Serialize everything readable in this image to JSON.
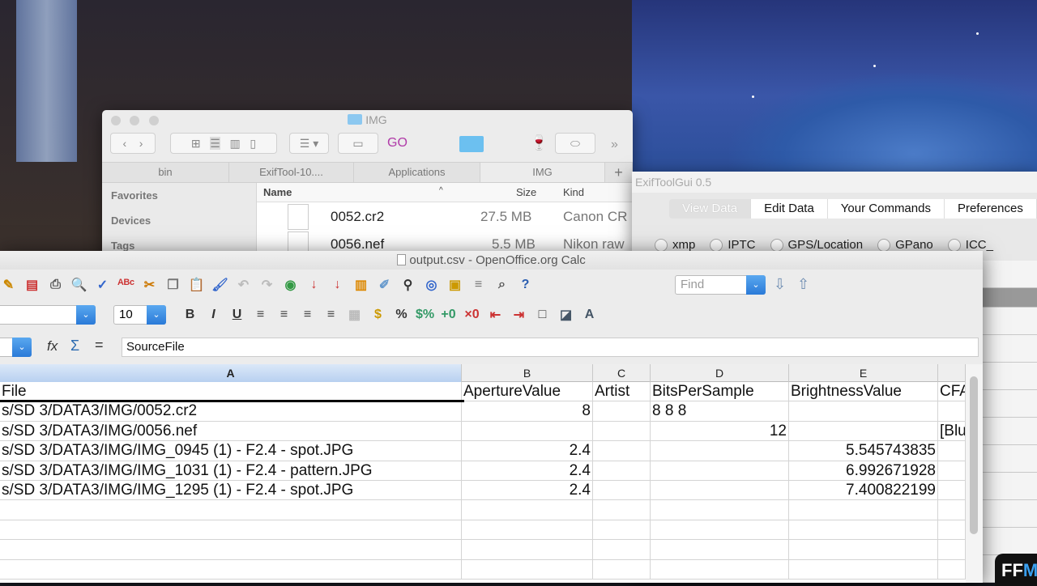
{
  "finder": {
    "title": "IMG",
    "go_label": "GO",
    "tabs": [
      "bin",
      "ExifTool-10....",
      "Applications",
      "IMG"
    ],
    "add_tab": "+",
    "sidebar": [
      "Favorites",
      "Devices",
      "Tags"
    ],
    "columns": {
      "name": "Name",
      "size": "Size",
      "kind": "Kind"
    },
    "files": [
      {
        "name": "0052.cr2",
        "size": "27.5 MB",
        "kind": "Canon CR"
      },
      {
        "name": "0056.nef",
        "size": "5.5 MB",
        "kind": "Nikon raw"
      }
    ]
  },
  "exiftoolgui": {
    "title": "ExifToolGui 0.5",
    "tabs": [
      "View Data",
      "Edit Data",
      "Your Commands",
      "Preferences"
    ],
    "radios": [
      "xmp",
      "IPTC",
      "GPS/Location",
      "GPano",
      "ICC_"
    ]
  },
  "calc": {
    "title": "output.csv - OpenOffice.org Calc",
    "font_size": "10",
    "find_placeholder": "Find",
    "formula": "SourceFile",
    "toolbar1": [
      [
        "edit-icon",
        "✎",
        "#c80"
      ],
      [
        "pdf-icon",
        "▤",
        "#c33"
      ],
      [
        "print-icon",
        "⎙",
        "#555"
      ],
      [
        "preview-icon",
        "🔍",
        "#555"
      ],
      [
        "spellcheck-icon",
        "✓",
        "#36c"
      ],
      [
        "autospell-icon",
        "ᴬᴮᶜ",
        "#c33"
      ],
      [
        "cut-icon",
        "✂",
        "#c70"
      ],
      [
        "copy-icon",
        "❐",
        "#777"
      ],
      [
        "paste-icon",
        "📋",
        "#a70"
      ],
      [
        "brush-icon",
        "🖌",
        "#36c"
      ],
      [
        "undo-icon",
        "↶",
        "#bbb"
      ],
      [
        "redo-icon",
        "↷",
        "#bbb"
      ],
      [
        "navigator-icon",
        "◉",
        "#394"
      ],
      [
        "sort-asc-icon",
        "↓",
        "#c33"
      ],
      [
        "sort-desc-icon",
        "↓",
        "#c33"
      ],
      [
        "chart-icon",
        "▥",
        "#d80"
      ],
      [
        "draw-icon",
        "✐",
        "#69c"
      ],
      [
        "find-icon",
        "⚲",
        "#333"
      ],
      [
        "navigator2-icon",
        "◎",
        "#36c"
      ],
      [
        "gallery-icon",
        "▣",
        "#c90"
      ],
      [
        "datasource-icon",
        "≡",
        "#777"
      ],
      [
        "zoom-icon",
        "⌕",
        "#555"
      ],
      [
        "help-icon",
        "?",
        "#2a5db0"
      ]
    ],
    "toolbar2": [
      [
        "bold-icon",
        "B",
        "#333"
      ],
      [
        "italic-icon",
        "I",
        "#333"
      ],
      [
        "underline-icon",
        "U",
        "#333"
      ],
      [
        "align-left-icon",
        "≡",
        "#444"
      ],
      [
        "align-center-icon",
        "≡",
        "#444"
      ],
      [
        "align-right-icon",
        "≡",
        "#444"
      ],
      [
        "justify-icon",
        "≡",
        "#444"
      ],
      [
        "merge-icon",
        "▦",
        "#bbb"
      ],
      [
        "currency-icon",
        "$",
        "#c90"
      ],
      [
        "percent-icon",
        "%",
        "#333"
      ],
      [
        "standard-format-icon",
        "$%",
        "#396"
      ],
      [
        "add-decimal-icon",
        "+0",
        "#396"
      ],
      [
        "delete-decimal-icon",
        "×0",
        "#c33"
      ],
      [
        "decrease-indent-icon",
        "⇤",
        "#c33"
      ],
      [
        "increase-indent-icon",
        "⇥",
        "#c33"
      ],
      [
        "borders-icon",
        "□",
        "#444"
      ],
      [
        "bgcolor-icon",
        "◪",
        "#456"
      ],
      [
        "fontcolor-icon",
        "A",
        "#456"
      ]
    ],
    "columns": [
      "A",
      "B",
      "C",
      "D",
      "E",
      ""
    ],
    "rows": [
      [
        "File",
        "ApertureValue",
        "Artist",
        "BitsPerSample",
        "BrightnessValue",
        "CFA"
      ],
      [
        "s/SD 3/DATA3/IMG/0052.cr2",
        "8",
        "",
        "8 8 8",
        "",
        ""
      ],
      [
        "s/SD 3/DATA3/IMG/0056.nef",
        "",
        "",
        "12",
        "",
        "[Blu"
      ],
      [
        "s/SD 3/DATA3/IMG/IMG_0945 (1) - F2.4 - spot.JPG",
        "2.4",
        "",
        "",
        "5.545743835",
        ""
      ],
      [
        "s/SD 3/DATA3/IMG/IMG_1031 (1) - F2.4 - pattern.JPG",
        "2.4",
        "",
        "",
        "6.992671928",
        ""
      ],
      [
        "s/SD 3/DATA3/IMG/IMG_1295 (1) - F2.4 - spot.JPG",
        "2.4",
        "",
        "",
        "7.400822199",
        ""
      ],
      [
        "",
        "",
        "",
        "",
        "",
        ""
      ],
      [
        "",
        "",
        "",
        "",
        "",
        ""
      ],
      [
        "",
        "",
        "",
        "",
        "",
        ""
      ],
      [
        "",
        "",
        "",
        "",
        "",
        ""
      ]
    ]
  },
  "watermark": "FFM"
}
